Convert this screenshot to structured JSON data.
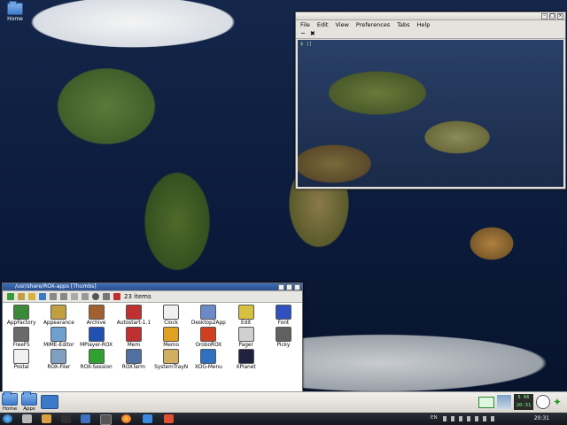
{
  "desktop": {
    "icons": [
      {
        "label": "Home"
      }
    ]
  },
  "terminal": {
    "menu": [
      "File",
      "Edit",
      "View",
      "Preferences",
      "Tabs",
      "Help"
    ],
    "prompt": "$ []"
  },
  "filer": {
    "title": "/usr/share/ROX-apps [Thumbs]",
    "item_count": "23 items",
    "items": [
      {
        "label": "AppFactory",
        "color": "#3a8a3a"
      },
      {
        "label": "Appearance",
        "color": "#c0a040"
      },
      {
        "label": "Archive",
        "color": "#a06030"
      },
      {
        "label": "Autostart-1.1",
        "color": "#c03030"
      },
      {
        "label": "Clock",
        "color": "#f0f0f0"
      },
      {
        "label": "Desktop2App",
        "color": "#6a8ac8"
      },
      {
        "label": "Edit",
        "color": "#d8c040"
      },
      {
        "label": "Font",
        "color": "#3050c0"
      },
      {
        "label": "FreeFS",
        "color": "#6a6a6a"
      },
      {
        "label": "MIME-Editor",
        "color": "#70a0d0"
      },
      {
        "label": "MPlayer-ROX",
        "color": "#2050b0"
      },
      {
        "label": "Mem",
        "color": "#c03030"
      },
      {
        "label": "Memo",
        "color": "#e0a020"
      },
      {
        "label": "OroboROX",
        "color": "#d04020"
      },
      {
        "label": "Pager",
        "color": "#d0d0d0"
      },
      {
        "label": "Picky",
        "color": "#606060"
      },
      {
        "label": "Postal",
        "color": "#f0f0f0"
      },
      {
        "label": "ROX-Filer",
        "color": "#80a0c0"
      },
      {
        "label": "ROX-Session",
        "color": "#30a030"
      },
      {
        "label": "ROXTerm",
        "color": "#5070a0"
      },
      {
        "label": "SystemTrayN",
        "color": "#d0b060"
      },
      {
        "label": "XDG-Menu",
        "color": "#3070c0"
      },
      {
        "label": "XPlanet",
        "color": "#202040"
      }
    ]
  },
  "panel": {
    "icons": [
      {
        "label": "Home"
      },
      {
        "label": "Apps"
      }
    ],
    "clock_top": "5 66",
    "clock_time": "20:31"
  },
  "taskbar": {
    "time": "20:31",
    "lang": "EN"
  }
}
